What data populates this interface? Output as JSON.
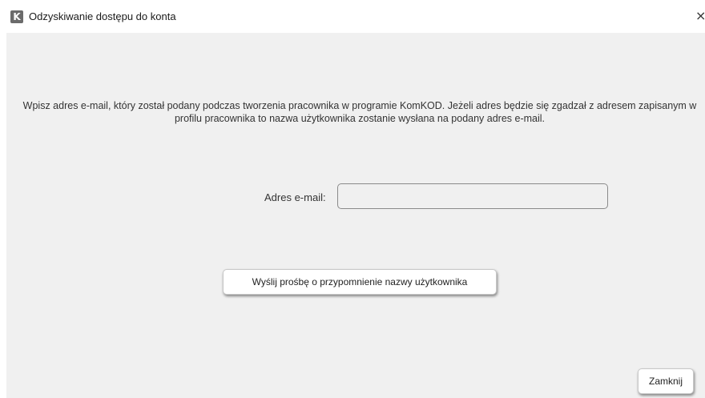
{
  "window": {
    "title": "Odzyskiwanie dostępu do konta",
    "app_icon_letter": "K",
    "close_glyph": "×"
  },
  "form": {
    "description": "Wpisz adres e-mail, który został podany podczas tworzenia pracownika w programie KomKOD. Jeżeli adres będzie się zgadzał z adresem zapisanym w profilu pracownika to nazwa użytkownika zostanie wysłana na podany adres e-mail.",
    "email_label": "Adres e-mail:",
    "email_value": "",
    "send_button_label": "Wyślij prośbę o przypomnienie nazwy użytkownika"
  },
  "footer": {
    "close_button_label": "Zamknij"
  },
  "colors": {
    "content_background": "#f0f0f0",
    "app_icon_background": "#6b6b6b"
  }
}
